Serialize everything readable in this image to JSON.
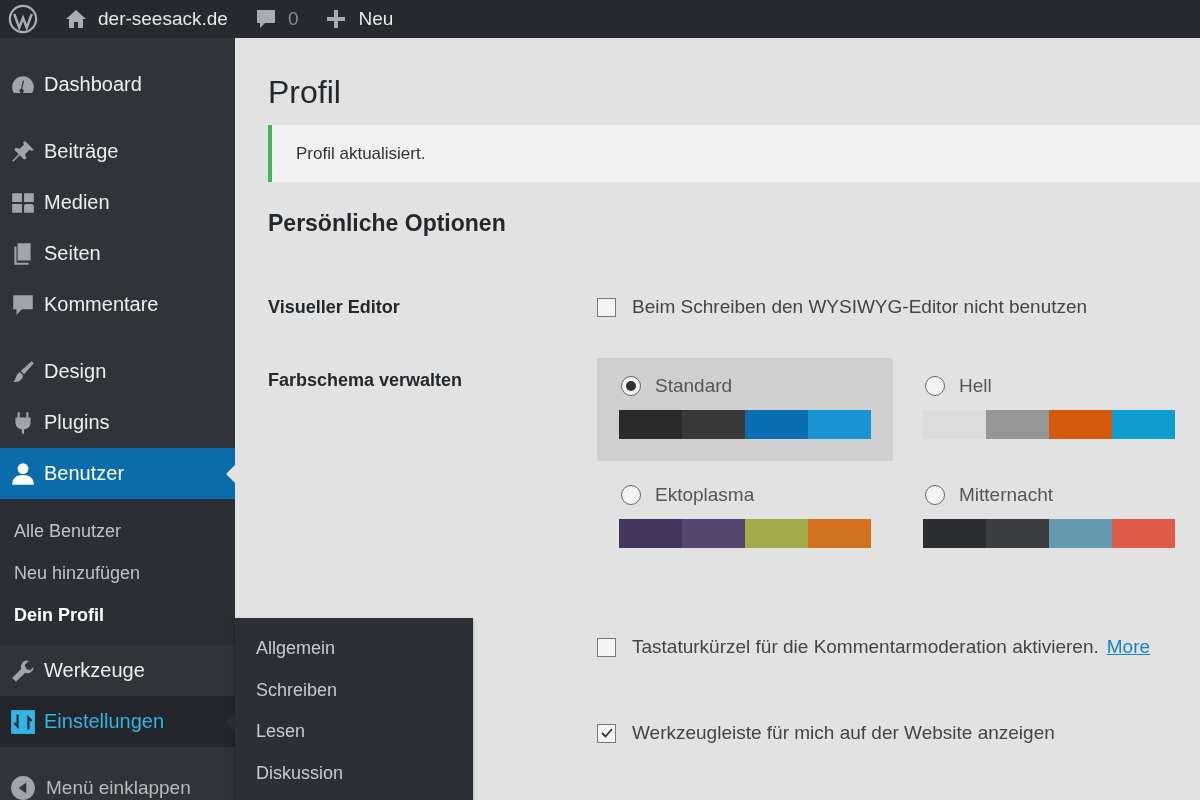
{
  "admin_bar": {
    "site": "der-seesack.de",
    "comments": "0",
    "new": "Neu"
  },
  "sidebar": {
    "groups": [
      {
        "items": [
          {
            "label": "Dashboard",
            "selected": false,
            "hovered": false
          }
        ]
      },
      {
        "items": [
          {
            "label": "Beiträge",
            "selected": false,
            "hovered": false
          },
          {
            "label": "Medien",
            "selected": false,
            "hovered": false
          },
          {
            "label": "Seiten",
            "selected": false,
            "hovered": false
          },
          {
            "label": "Kommentare",
            "selected": false,
            "hovered": false
          }
        ]
      },
      {
        "items": [
          {
            "label": "Design",
            "selected": false,
            "hovered": false
          },
          {
            "label": "Plugins",
            "selected": false,
            "hovered": false
          },
          {
            "label": "Benutzer",
            "selected": true,
            "hovered": false,
            "children": [
              {
                "label": "Alle Benutzer",
                "selected": false
              },
              {
                "label": "Neu hinzufügen",
                "selected": false
              },
              {
                "label": "Dein Profil",
                "selected": true
              }
            ]
          },
          {
            "label": "Werkzeuge",
            "selected": false,
            "hovered": false
          },
          {
            "label": "Einstellungen",
            "selected": false,
            "hovered": true,
            "children": [
              {
                "label": "Allgemein",
                "selected": false
              },
              {
                "label": "Schreiben",
                "selected": false
              },
              {
                "label": "Lesen",
                "selected": false
              },
              {
                "label": "Diskussion",
                "selected": false
              }
            ]
          }
        ]
      }
    ],
    "collapse": "Menü einklappen"
  },
  "page_title": "Profil",
  "notice": {
    "text": "Profil aktualisiert."
  },
  "section_title": "Persönliche Optionen",
  "fields": [
    {
      "kind": "checkbox",
      "label": "Visueller Editor",
      "text": "Beim Schreiben den WYSIWYG-Editor nicht benutzen",
      "checked": false
    },
    {
      "kind": "color_schemes",
      "label": "Farbschema verwalten",
      "options": [
        {
          "name": "Standard",
          "selected": true,
          "colors": [
            {
              "color": "#2a2a2a"
            },
            {
              "color": "#393939"
            },
            {
              "color": "#0a6fb0"
            },
            {
              "color": "#1a94d2"
            }
          ]
        },
        {
          "name": "Hell",
          "selected": false,
          "colors": [
            {
              "color": "#dcdcdc"
            },
            {
              "color": "#969696"
            },
            {
              "color": "#d65a0e"
            },
            {
              "color": "#0f9dd0"
            }
          ]
        },
        {
          "name": "Ektoplasma",
          "selected": false,
          "colors": [
            {
              "color": "#44375e"
            },
            {
              "color": "#55476f"
            },
            {
              "color": "#a1ab48"
            },
            {
              "color": "#d2721f"
            }
          ]
        },
        {
          "name": "Mitternacht",
          "selected": false,
          "colors": [
            {
              "color": "#2c2d30"
            },
            {
              "color": "#3b3d40"
            },
            {
              "color": "#6499af"
            },
            {
              "color": "#dd5b47"
            }
          ]
        }
      ]
    },
    {
      "kind": "checkbox",
      "text": "Tastaturkürzel für die Kommentarmoderation aktivieren.",
      "link": "More",
      "checked": false
    },
    {
      "kind": "checkbox",
      "text": "Werkzeugleiste für mich auf der Website anzeigen",
      "checked": true
    }
  ]
}
